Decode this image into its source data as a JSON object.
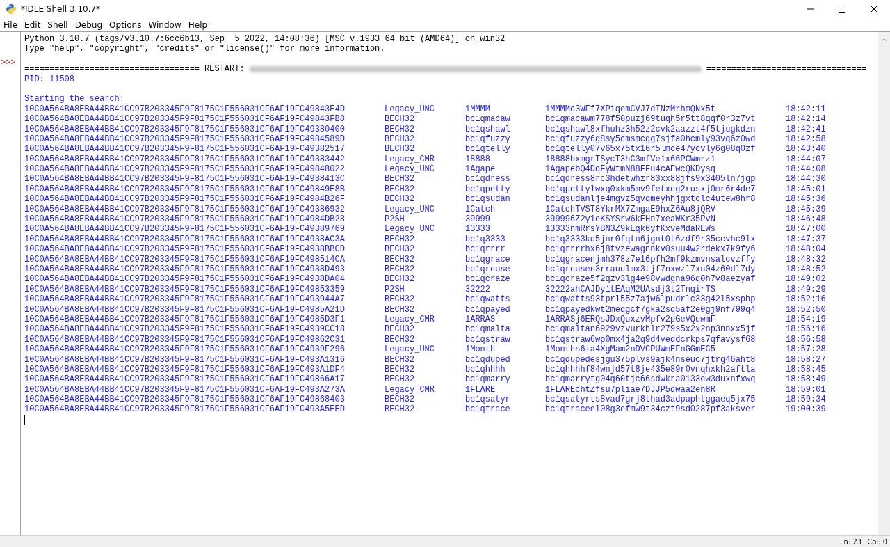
{
  "window": {
    "title": "*IDLE Shell 3.10.7*"
  },
  "menu": [
    "File",
    "Edit",
    "Shell",
    "Debug",
    "Options",
    "Window",
    "Help"
  ],
  "shell": {
    "banner": [
      "Python 3.10.7 (tags/v3.10.7:6cc6b13, Sep  5 2022, 14:08:36) [MSC v.1933 64 bit (AMD64)] on win32",
      "Type \"help\", \"copyright\", \"credits\" or \"license()\" for more information."
    ],
    "prompt": ">>>",
    "restart": {
      "left": "===================================",
      "label": "RESTART:",
      "right": "================================"
    },
    "pid": "PID: 11508",
    "message": "Starting the search!",
    "results": [
      {
        "key": "10C0A564BA8EBA44BB41CC97B203345F9F8175C1F556031CF6AF19FC49843E4D",
        "type": "Legacy_UNC",
        "prefix": "1MMMM",
        "address": "1MMMMc3WFf7XPiqemCVJ7dTNzMrhmQNx5t",
        "time": "18:42:11"
      },
      {
        "key": "10C0A564BA8EBA44BB41CC97B203345F9F8175C1F556031CF6AF19FC49843FB8",
        "type": "BECH32",
        "prefix": "bc1qmacaw",
        "address": "bc1qmacawm778f50puzj69tuqh5r5tt8qqf0r3z7vt",
        "time": "18:42:14"
      },
      {
        "key": "10C0A564BA8EBA44BB41CC97B203345F9F8175C1F556031CF6AF19FC49380400",
        "type": "BECH32",
        "prefix": "bc1qshawl",
        "address": "bc1qshawl8xfhuhz3h52z2cvk2aazzt4f5tjugkdzn",
        "time": "18:42:41"
      },
      {
        "key": "10C0A564BA8EBA44BB41CC97B203345F9F8175C1F556031CF6AF19FC4984589D",
        "type": "BECH32",
        "prefix": "bc1qfuzzy",
        "address": "bc1qfuzzy6g8sy5cmsmcgg7sjfa0hcmly93vq6z0wd",
        "time": "18:42:58"
      },
      {
        "key": "10C0A564BA8EBA44BB41CC97B203345F9F8175C1F556031CF6AF19FC49382517",
        "type": "BECH32",
        "prefix": "bc1qtelly",
        "address": "bc1qtelly07v65x75tx16r5lmce47ycvly6g08q0zf",
        "time": "18:43:40"
      },
      {
        "key": "10C0A564BA8EBA44BB41CC97B203345F9F8175C1F556031CF6AF19FC49383442",
        "type": "Legacy_CMR",
        "prefix": "18888",
        "address": "18888bxmgrTSycT3hC3mfVe1x66PCWmrz1",
        "time": "18:44:07"
      },
      {
        "key": "10C0A564BA8EBA44BB41CC97B203345F9F8175C1F556031CF6AF19FC49848022",
        "type": "Legacy_UNC",
        "prefix": "1Agape",
        "address": "1AgapebQ4DqFyWtmN88FFu4cAEwcQKDysq",
        "time": "18:44:08"
      },
      {
        "key": "10C0A564BA8EBA44BB41CC97B203345F9F8175C1F556031CF6AF19FC4938413C",
        "type": "BECH32",
        "prefix": "bc1qdress",
        "address": "bc1qdress8rc3hdetwhzr83xx88jfs9x3405ln7jgp",
        "time": "18:44:30"
      },
      {
        "key": "10C0A564BA8EBA44BB41CC97B203345F9F8175C1F556031CF6AF19FC49849E8B",
        "type": "BECH32",
        "prefix": "bc1qpetty",
        "address": "bc1qpettylwxq0xkm5mv9fetxeg2rusxj0mr6r4de7",
        "time": "18:45:01"
      },
      {
        "key": "10C0A564BA8EBA44BB41CC97B203345F9F8175C1F556031CF6AF19FC4984B26F",
        "type": "BECH32",
        "prefix": "bc1qsudan",
        "address": "bc1qsudanlje4mgvz5qvqmeyhhjgxtclc4utew8hr8",
        "time": "18:45:36"
      },
      {
        "key": "10C0A564BA8EBA44BB41CC97B203345F9F8175C1F556031CF6AF19FC49386932",
        "type": "Legacy_UNC",
        "prefix": "1Catch",
        "address": "1CatchTVST8YkrMX7ZmgaE9hxZ6Au8jQRV",
        "time": "18:45:39"
      },
      {
        "key": "10C0A564BA8EBA44BB41CC97B203345F9F8175C1F556031CF6AF19FC4984DB28",
        "type": "P2SH",
        "prefix": "39999",
        "address": "399996Z2y1eKSYSrw6kEHn7xeaWKr35PvN",
        "time": "18:46:48"
      },
      {
        "key": "10C0A564BA8EBA44BB41CC97B203345F9F8175C1F556031CF6AF19FC49389769",
        "type": "Legacy_UNC",
        "prefix": "13333",
        "address": "13333nmRrsYBN3Z9kEqk6yfKxveMdaREWs",
        "time": "18:47:00"
      },
      {
        "key": "10C0A564BA8EBA44BB41CC97B203345F9F8175C1F556031CF6AF19FC4938AC3A",
        "type": "BECH32",
        "prefix": "bc1q3333",
        "address": "bc1q3333kc5jnr0fqtn6jgnt0t6zdf9r35ccvhc9lx",
        "time": "18:47:37"
      },
      {
        "key": "10C0A564BA8EBA44BB41CC97B203345F9F8175C1F556031CF6AF19FC4938BBCD",
        "type": "BECH32",
        "prefix": "bc1qrrrr",
        "address": "bc1qrrrrhx6j8tvzewagnnkv0suu4w2rdekx7k9fy6",
        "time": "18:48:04"
      },
      {
        "key": "10C0A564BA8EBA44BB41CC97B203345F9F8175C1F556031CF6AF19FC498514CA",
        "type": "BECH32",
        "prefix": "bc1qgrace",
        "address": "bc1qgracenjmh378z7e16pfh2mf9kzmvnsalcvzffy",
        "time": "18:48:32"
      },
      {
        "key": "10C0A564BA8EBA44BB41CC97B203345F9F8175C1F556031CF6AF19FC4938D493",
        "type": "BECH32",
        "prefix": "bc1qreuse",
        "address": "bc1qreusen3rrauulmx3tjf7nxwzl7xu04z60dl7dy",
        "time": "18:48:52"
      },
      {
        "key": "10C0A564BA8EBA44BB41CC97B203345F9F8175C1F556031CF6AF19FC4938DA04",
        "type": "BECH32",
        "prefix": "bc1qcraze",
        "address": "bc1qcraze5f2qzv3lg4e98vwdgna96q0h7v8aezyaf",
        "time": "18:49:02"
      },
      {
        "key": "10C0A564BA8EBA44BB41CC97B203345F9F8175C1F556031CF6AF19FC49853359",
        "type": "P2SH",
        "prefix": "32222",
        "address": "32222ahCAJDy1tEAqM2UAsdj3t2TnqirTS",
        "time": "18:49:29"
      },
      {
        "key": "10C0A564BA8EBA44BB41CC97B203345F9F8175C1F556031CF6AF19FC493944A7",
        "type": "BECH32",
        "prefix": "bc1qwatts",
        "address": "bc1qwatts93tprl55z7ajw6lpudrlc33g42l5xsphp",
        "time": "18:52:16"
      },
      {
        "key": "10C0A564BA8EBA44BB41CC97B203345F9F8175C1F556031CF6AF19FC4985A21D",
        "type": "BECH32",
        "prefix": "bc1qpayed",
        "address": "bc1qpayedkwt2meqgcf7gka2sq5af2e0gj9nf799q4",
        "time": "18:52:50"
      },
      {
        "key": "10C0A564BA8EBA44BB41CC97B203345F9F8175C1F556031CF6AF19FC4985D3F1",
        "type": "Legacy_CMR",
        "prefix": "1ARRAS",
        "address": "1ARRASj6ERQsJDxQuxzvMpfv2pGeVQuwmF",
        "time": "18:54:19"
      },
      {
        "key": "10C0A564BA8EBA44BB41CC97B203345F9F8175C1F556031CF6AF19FC4939CC18",
        "type": "BECH32",
        "prefix": "bc1qmalta",
        "address": "bc1qmaltan6929vzvurkhlr279s5x2x2np3nnxx5jf",
        "time": "18:56:16"
      },
      {
        "key": "10C0A564BA8EBA44BB41CC97B203345F9F8175C1F556031CF6AF19FC49862C31",
        "type": "BECH32",
        "prefix": "bc1qstraw",
        "address": "bc1qstraw6wp0mx4ja2q9d4veddcrkps7qfavysf68",
        "time": "18:56:58"
      },
      {
        "key": "10C0A564BA8EBA44BB41CC97B203345F9F8175C1F556031CF6AF19FC4939F296",
        "type": "Legacy_UNC",
        "prefix": "1Month",
        "address": "1Months6ia4XgMam2nDVCPUWmEFnGGmEC5",
        "time": "18:57:28"
      },
      {
        "key": "10C0A564BA8EBA44BB41CC97B203345F9F8175C1F556031CF6AF19FC493A1316",
        "type": "BECH32",
        "prefix": "bc1qduped",
        "address": "bc1qdupedesjgu375plvs9ajk4nseuc7jtrg46aht8",
        "time": "18:58:27"
      },
      {
        "key": "10C0A564BA8EBA44BB41CC97B203345F9F8175C1F556031CF6AF19FC493A1DF4",
        "type": "BECH32",
        "prefix": "bc1qhhhh",
        "address": "bc1qhhhhf84wnjd57t8je435e89r0vnqhxkh2aftla",
        "time": "18:58:45"
      },
      {
        "key": "10C0A564BA8EBA44BB41CC97B203345F9F8175C1F556031CF6AF19FC49866A17",
        "type": "BECH32",
        "prefix": "bc1qmarry",
        "address": "bc1qmarrytg04q60tjc66sdwkra0133ew3duxnfxwq",
        "time": "18:58:49"
      },
      {
        "key": "10C0A564BA8EBA44BB41CC97B203345F9F8175C1F556031CF6AF19FC493A273A",
        "type": "Legacy_CMR",
        "prefix": "1FLARE",
        "address": "1FLAREchtZfsu7pliae7DJJP5dwaa2en8R",
        "time": "18:59:01"
      },
      {
        "key": "10C0A564BA8EBA44BB41CC97B203345F9F8175C1F556031CF6AF19FC49868403",
        "type": "BECH32",
        "prefix": "bc1qsatyr",
        "address": "bc1qsatyrts8vad7grj8thad3adpaphtggaeq5jx75",
        "time": "18:59:34"
      },
      {
        "key": "10C0A564BA8EBA44BB41CC97B203345F9F8175C1F556031CF6AF19FC493A5EED",
        "type": "BECH32",
        "prefix": "bc1qtrace",
        "address": "bc1qtraceel08g3efmw9t34czt9sd0287pf3aksver",
        "time": "19:00:39"
      }
    ]
  },
  "status_bar": {
    "line": "Ln: 23",
    "column": "Col: 0"
  }
}
